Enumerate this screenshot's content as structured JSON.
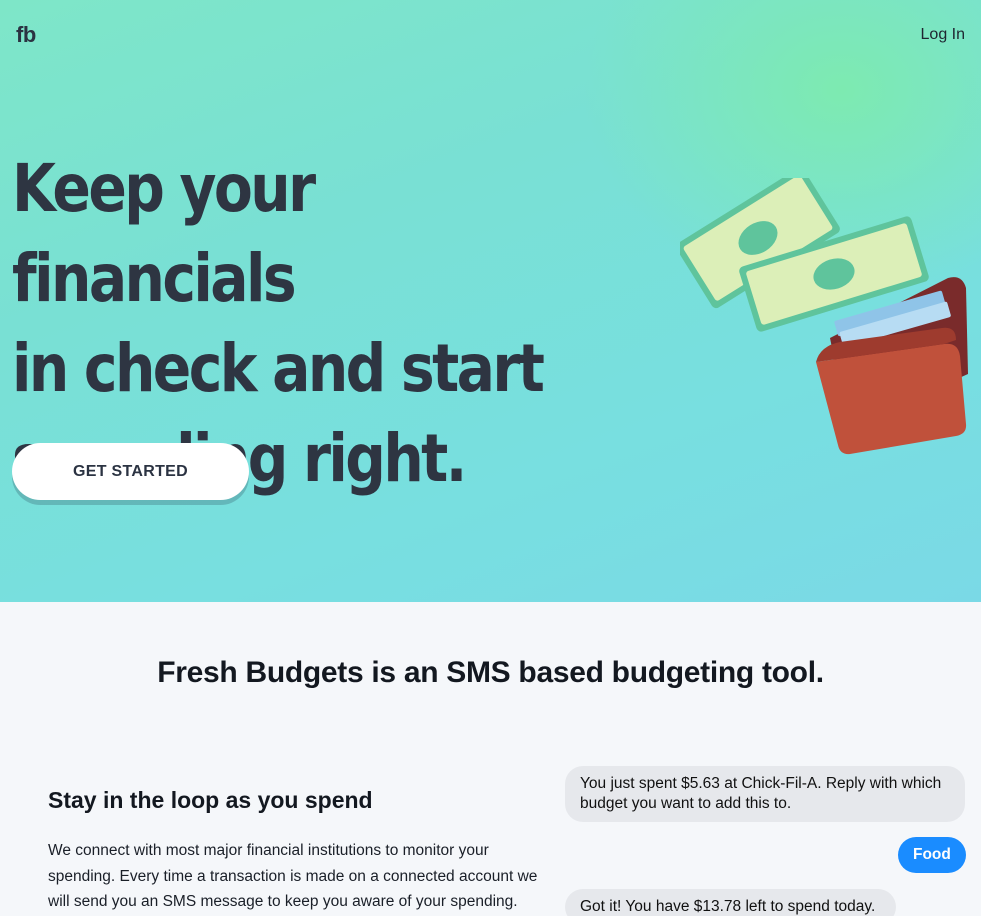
{
  "nav": {
    "logo": "fb",
    "login_label": "Log In"
  },
  "hero": {
    "headline_lines": [
      "Keep your financials",
      "in check and start",
      "spending right."
    ],
    "cta_label": "GET STARTED",
    "illustration": "money-wallet-illustration"
  },
  "intro": {
    "title": "Fresh Budgets is an SMS based budgeting tool."
  },
  "feature": {
    "title": "Stay in the loop as you spend",
    "body": "We connect with most major financial institutions to monitor your spending. Every time a transaction is made on a connected account we will send you an SMS message to keep you aware of your spending."
  },
  "chat": {
    "messages": [
      {
        "from": "bot",
        "text": "You just spent $5.63 at Chick-Fil-A. Reply with which budget you want to add this to."
      },
      {
        "from": "user",
        "text": "Food"
      },
      {
        "from": "bot",
        "text": "Got it! You have $13.78 left to spend today."
      }
    ]
  },
  "colors": {
    "hero_gradient_start": "#7ee6c8",
    "hero_gradient_end": "#7ad9e6",
    "headline": "#2e3542",
    "bubble_in": "#e6e8ec",
    "bubble_out": "#1a8cff",
    "page_background": "#f5f7fa"
  }
}
